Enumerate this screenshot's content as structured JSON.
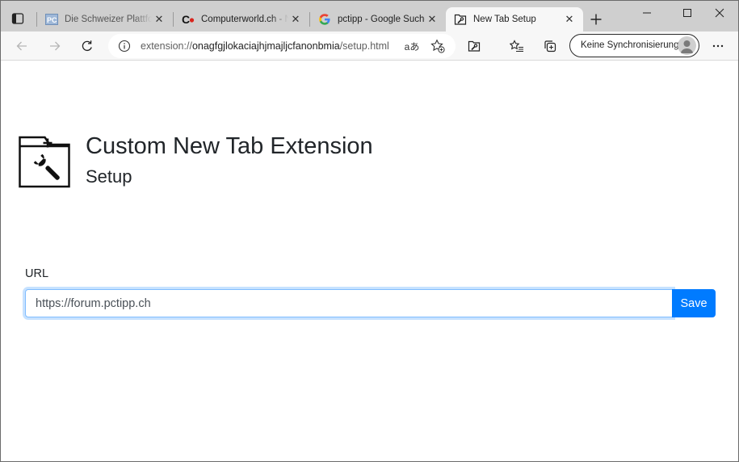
{
  "browser": {
    "tabs": [
      {
        "title": "Die Schweizer Plattform",
        "favicon": "pctipp-icon"
      },
      {
        "title": "Computerworld.ch - News",
        "favicon": "computerworld-icon"
      },
      {
        "title": "pctipp - Google Suche",
        "favicon": "google-icon"
      },
      {
        "title": "New Tab Setup",
        "favicon": "extension-page-icon",
        "active": true
      }
    ],
    "address": {
      "scheme": "extension://",
      "host": "onagfgjlokaciajhjmajljcfanonbmia",
      "path": "/setup.html"
    },
    "read_aloud_label": "aあ",
    "sync_label": "Keine Synchronisierung"
  },
  "page": {
    "title": "Custom New Tab Extension",
    "subtitle": "Setup",
    "url_label": "URL",
    "url_value": "https://forum.pctipp.ch",
    "save_label": "Save"
  },
  "colors": {
    "accent": "#007bff",
    "tabstrip": "#cfcfcf",
    "toolbar": "#f7f7f7"
  }
}
